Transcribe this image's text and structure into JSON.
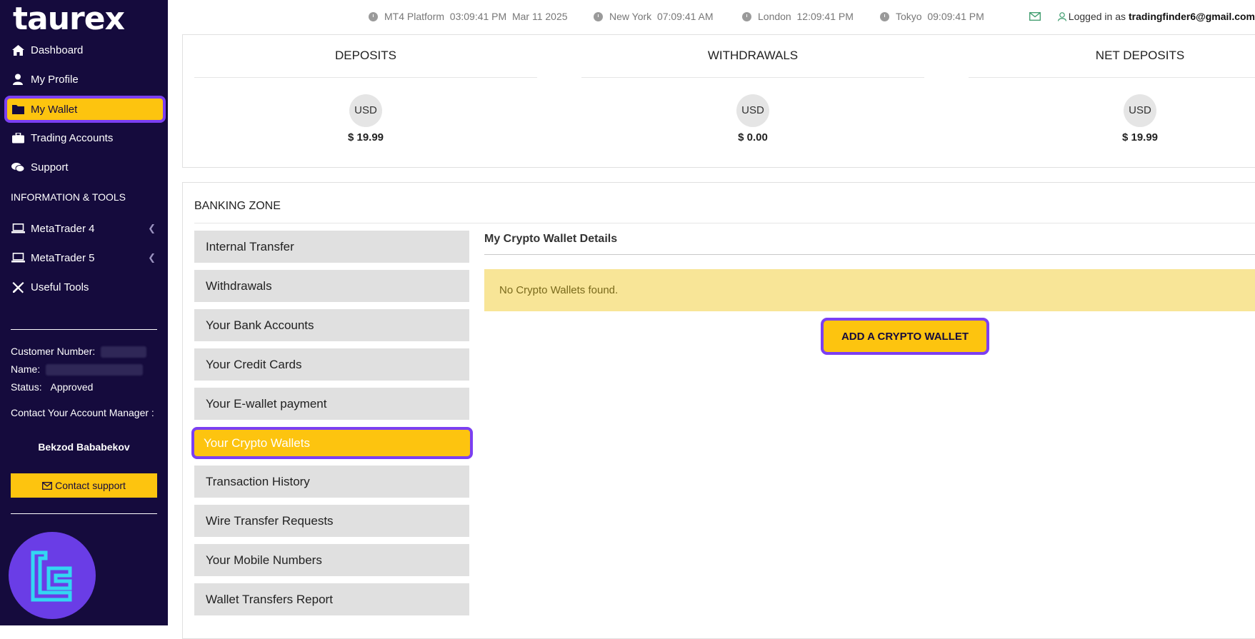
{
  "brand": {
    "logo_text": "taurex"
  },
  "sidebar": {
    "nav": [
      {
        "label": "Dashboard",
        "icon": "home-icon"
      },
      {
        "label": "My Profile",
        "icon": "user-icon"
      },
      {
        "label": "My Wallet",
        "icon": "folder-icon",
        "active": true
      },
      {
        "label": "Trading Accounts",
        "icon": "briefcase-icon"
      },
      {
        "label": "Support",
        "icon": "comments-icon"
      }
    ],
    "section_label": "INFORMATION & TOOLS",
    "tools": [
      {
        "label": "MetaTrader 4",
        "icon": "laptop-icon",
        "has_submenu": true
      },
      {
        "label": "MetaTrader 5",
        "icon": "laptop-icon",
        "has_submenu": true
      },
      {
        "label": "Useful Tools",
        "icon": "tools-icon"
      }
    ],
    "customer_number_label": "Customer Number:",
    "name_label": "Name:",
    "status_label": "Status:",
    "status_value": "Approved",
    "account_manager_label": "Contact Your Account Manager :",
    "account_manager_name": "Bekzod Bababekov",
    "contact_button": "Contact support"
  },
  "topbar": {
    "clocks": [
      {
        "label": "MT4 Platform",
        "time": "03:09:41 PM",
        "date": "Mar 11 2025"
      },
      {
        "label": "New York",
        "time": "07:09:41 AM"
      },
      {
        "label": "London",
        "time": "12:09:41 PM"
      },
      {
        "label": "Tokyo",
        "time": "09:09:41 PM"
      }
    ],
    "logged_in_prefix": "Logged in as",
    "logged_in_email": "tradingfinder6@gmail.com"
  },
  "stats": [
    {
      "title": "DEPOSITS",
      "currency": "USD",
      "amount": "$ 19.99"
    },
    {
      "title": "WITHDRAWALS",
      "currency": "USD",
      "amount": "$ 0.00"
    },
    {
      "title": "NET DEPOSITS",
      "currency": "USD",
      "amount": "$ 19.99"
    }
  ],
  "banking": {
    "title": "BANKING ZONE",
    "menu": [
      "Internal Transfer",
      "Withdrawals",
      "Your Bank Accounts",
      "Your Credit Cards",
      "Your E-wallet payment",
      "Your Crypto Wallets",
      "Transaction History",
      "Wire Transfer Requests",
      "Your Mobile Numbers",
      "Wallet Transfers Report"
    ],
    "active_index": 5,
    "panel_title": "My Crypto Wallet Details",
    "empty_message": "No Crypto Wallets found.",
    "add_button": "ADD A CRYPTO WALLET"
  },
  "colors": {
    "sidebar_bg": "#150b3d",
    "accent_yellow": "#fdc40f",
    "highlight_purple": "#7b3ff2"
  }
}
